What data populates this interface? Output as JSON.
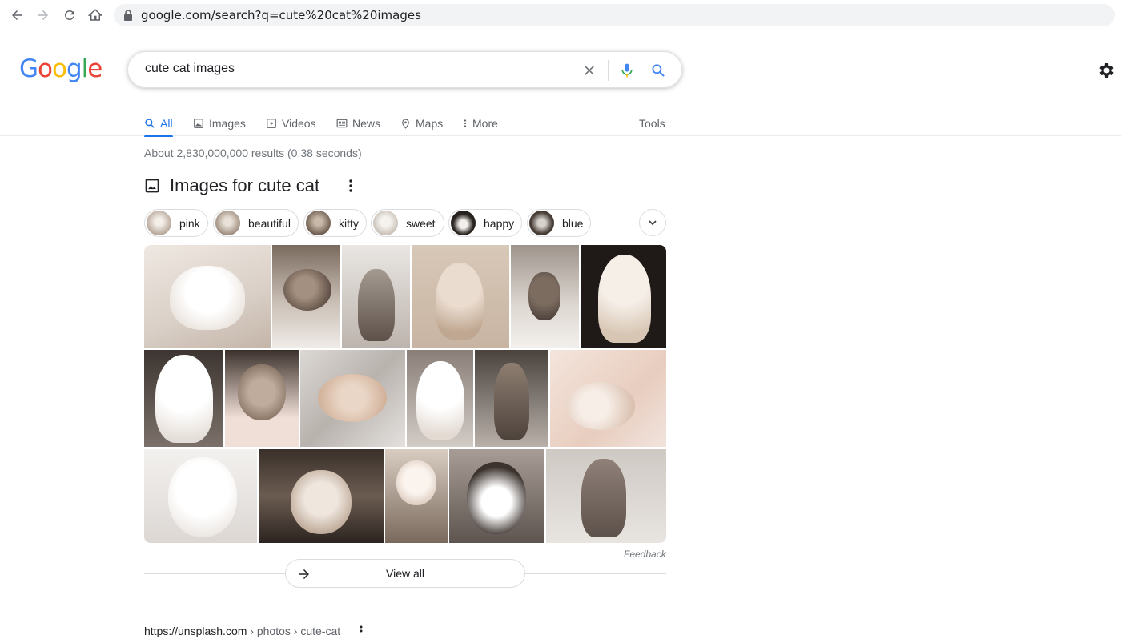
{
  "browser": {
    "url": "google.com/search?q=cute%20cat%20images",
    "icons": [
      "back-arrow-icon",
      "forward-arrow-icon",
      "reload-icon",
      "home-icon",
      "lock-icon"
    ]
  },
  "logo": {
    "text": "Google",
    "colors": [
      "#4285f4",
      "#ea4335",
      "#fbbc05",
      "#4285f4",
      "#34a853",
      "#ea4335"
    ]
  },
  "search": {
    "query": "cute cat images"
  },
  "tabs": [
    {
      "label": "All",
      "icon": "search-icon",
      "active": true
    },
    {
      "label": "Images",
      "icon": "image-icon"
    },
    {
      "label": "Videos",
      "icon": "video-icon"
    },
    {
      "label": "News",
      "icon": "news-icon"
    },
    {
      "label": "Maps",
      "icon": "map-pin-icon"
    },
    {
      "label": "More",
      "icon": "more-vert-icon"
    }
  ],
  "tools_label": "Tools",
  "stats": "About 2,830,000,000 results (0.38 seconds)",
  "images_section": {
    "title": "Images for cute cat",
    "chips": [
      "pink",
      "beautiful",
      "kitty",
      "sweet",
      "happy",
      "blue"
    ],
    "feedback": "Feedback",
    "view_all": "View all"
  },
  "next_result": {
    "domain": "https://unsplash.com",
    "crumb": " › photos › cute-cat"
  }
}
